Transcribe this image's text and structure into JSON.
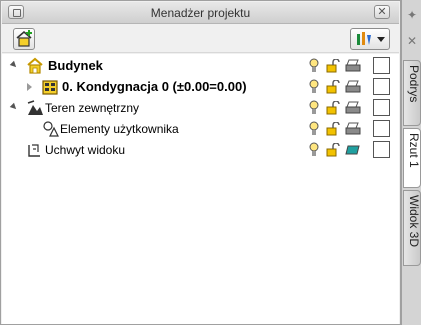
{
  "window": {
    "title": "Menadżer projektu"
  },
  "side_tabs": [
    "Podrys",
    "Rzut 1",
    "Widok 3D"
  ],
  "tree": [
    {
      "label": "Budynek",
      "bold": true
    },
    {
      "label": "0. Kondygnacja 0 (±0.00=0.00)",
      "bold": true
    },
    {
      "label": "Teren zewnętrzny",
      "bold": false
    },
    {
      "label": "Elementy użytkownika",
      "bold": false
    },
    {
      "label": "Uchwyt widoku",
      "bold": false
    }
  ],
  "colors": {
    "accent_yellow": "#f2c200",
    "printer": "#6d6d6d",
    "camera_teal": "#20a0a0"
  }
}
